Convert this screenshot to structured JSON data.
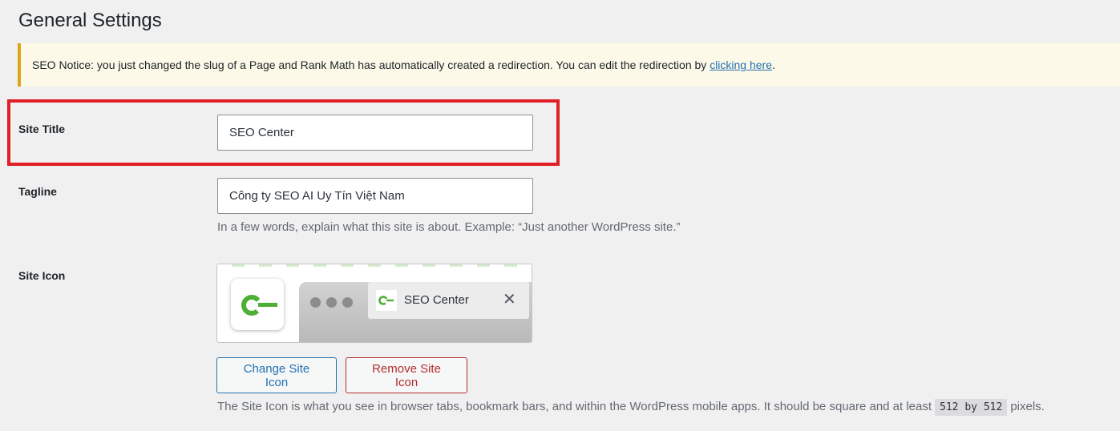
{
  "page": {
    "title": "General Settings"
  },
  "notice": {
    "text": "SEO Notice: you just changed the slug of a Page and Rank Math has automatically created a redirection. You can edit the redirection by ",
    "link_text": "clicking here",
    "suffix": "."
  },
  "site_title": {
    "label": "Site Title",
    "value": "SEO Center"
  },
  "tagline": {
    "label": "Tagline",
    "value": "Công ty SEO AI Uy Tín Việt Nam",
    "description": "In a few words, explain what this site is about. Example: “Just another WordPress site.”"
  },
  "site_icon": {
    "label": "Site Icon",
    "icon": "seo-center-key-logo",
    "accent_color": "#4caf36",
    "preview_tab_title": "SEO Center",
    "close_glyph": "✕",
    "change_button": "Change Site Icon",
    "remove_button": "Remove Site Icon",
    "description_pre": "The Site Icon is what you see in browser tabs, bookmark bars, and within the WordPress mobile apps. It should be square and at least",
    "description_code": "512 by 512",
    "description_post": "pixels."
  },
  "colors": {
    "highlight": "#e01f26",
    "link": "#2271b1",
    "danger": "#b32d2e",
    "notice_border": "#dba617"
  }
}
